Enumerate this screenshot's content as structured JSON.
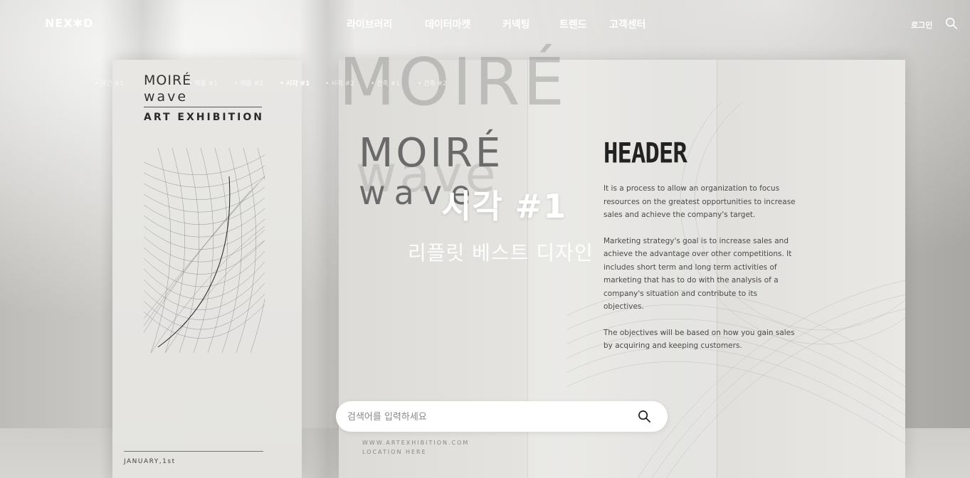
{
  "nav": {
    "logo": "NEX✱D",
    "menu": [
      "라이브러리",
      "데이터마켓",
      "커넥팅",
      "트렌드",
      "고객센터"
    ],
    "login": "로그인",
    "search_icon": "search-icon"
  },
  "categories": [
    {
      "label": "• 공간 #1",
      "active": false
    },
    {
      "label": "• 제품 #1",
      "active": false
    },
    {
      "label": "• 제품 #2",
      "active": false
    },
    {
      "label": "• 시각 #1",
      "active": true
    },
    {
      "label": "• 시각 #2",
      "active": false
    },
    {
      "label": "• 건축 #1",
      "active": false
    },
    {
      "label": "• 건축 #2",
      "active": false
    }
  ],
  "hero": {
    "title": "시각 #1",
    "subtitle": "리플릿 베스트 디자인"
  },
  "search": {
    "placeholder": "검색어를 입력하세요",
    "value": ""
  },
  "poster_left": {
    "title_line1": "MOIRÉ",
    "title_line2": "wave",
    "subtitle": "ART EXHIBITION",
    "date": "JANUARY,1st"
  },
  "poster_big": {
    "bg_text": "MOIRÉ",
    "bg_text2": "wave",
    "title_line1": "MOIRÉ",
    "title_line2": "wave",
    "header": "HEADER",
    "paragraphs": [
      "It is a process to allow an organization to focus resources on the greatest opportunities to increase sales and achieve the company's target.",
      "Marketing strategy's goal is to increase sales and achieve the advantage over other competitions. It includes short term and long term activities of marketing that has to do with the analysis of a company's situation and contribute to its objectives.",
      "The objectives will be based on how you gain sales by acquiring and keeping customers."
    ],
    "url": "WWW.ARTEXHIBITION.COM",
    "location": "LOCATION HERE"
  }
}
